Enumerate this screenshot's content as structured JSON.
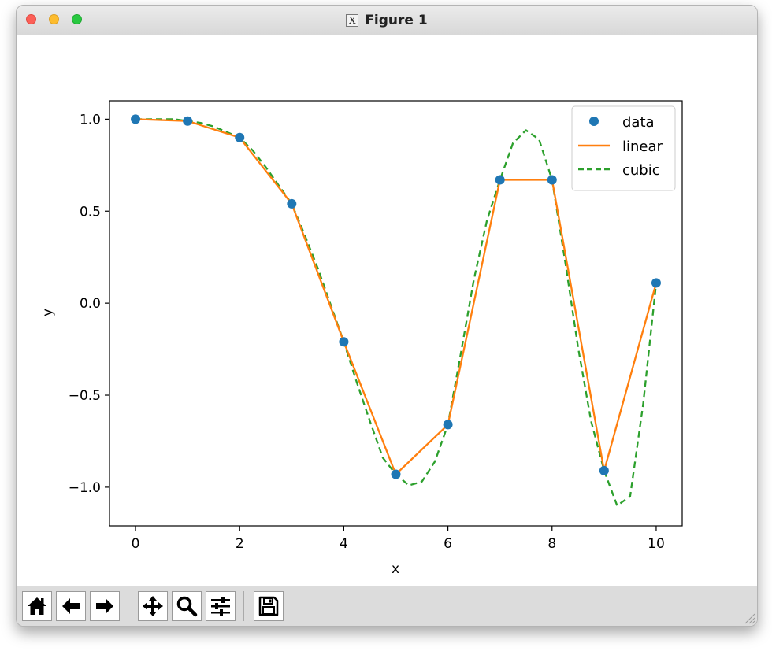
{
  "window": {
    "title": "Figure 1",
    "title_icon": "X"
  },
  "toolbar": {
    "buttons": [
      {
        "name": "home-button",
        "icon": "home-icon"
      },
      {
        "name": "back-button",
        "icon": "arrow-left-icon"
      },
      {
        "name": "forward-button",
        "icon": "arrow-right-icon"
      },
      {
        "name": "pan-button",
        "icon": "move-icon"
      },
      {
        "name": "zoom-button",
        "icon": "magnifier-icon"
      },
      {
        "name": "configure-subplots-button",
        "icon": "sliders-icon"
      },
      {
        "name": "save-button",
        "icon": "floppy-disk-icon"
      }
    ]
  },
  "chart_data": {
    "type": "line",
    "xlabel": "x",
    "ylabel": "y",
    "xlim": [
      -0.5,
      10.5
    ],
    "ylim": [
      -1.21,
      1.1
    ],
    "xticks": [
      0,
      2,
      4,
      6,
      8,
      10
    ],
    "xtick_labels": [
      "0",
      "2",
      "4",
      "6",
      "8",
      "10"
    ],
    "yticks": [
      1.0,
      0.5,
      0.0,
      -0.5,
      -1.0
    ],
    "ytick_labels": [
      "1.0",
      "0.5",
      "0.0",
      "−0.5",
      "−1.0"
    ],
    "grid": false,
    "legend_position": "top-right",
    "series": [
      {
        "name": "data",
        "style": "markers",
        "color": "#1f77b4",
        "x": [
          0,
          1,
          2,
          3,
          4,
          5,
          6,
          7,
          8,
          9,
          10
        ],
        "y": [
          1.0,
          0.99,
          0.9,
          0.54,
          -0.21,
          -0.93,
          -0.66,
          0.67,
          0.67,
          -0.91,
          0.11
        ]
      },
      {
        "name": "linear",
        "style": "solid",
        "color": "#ff7f0e",
        "x": [
          0,
          1,
          2,
          3,
          4,
          5,
          6,
          7,
          8,
          9,
          10
        ],
        "y": [
          1.0,
          0.99,
          0.9,
          0.54,
          -0.21,
          -0.93,
          -0.66,
          0.67,
          0.67,
          -0.91,
          0.11
        ]
      },
      {
        "name": "cubic",
        "style": "dashed",
        "color": "#2ca02c",
        "x": [
          0,
          0.25,
          0.5,
          0.75,
          1,
          1.25,
          1.5,
          1.75,
          2,
          2.25,
          2.5,
          2.75,
          3,
          3.25,
          3.5,
          3.75,
          4,
          4.25,
          4.5,
          4.75,
          5,
          5.25,
          5.5,
          5.75,
          6,
          6.25,
          6.5,
          6.75,
          7,
          7.25,
          7.5,
          7.75,
          8,
          8.25,
          8.5,
          8.75,
          9,
          9.25,
          9.5,
          9.75,
          10
        ],
        "y": [
          1.0,
          1.0,
          1.0,
          1.0,
          0.99,
          0.98,
          0.96,
          0.93,
          0.9,
          0.83,
          0.74,
          0.64,
          0.54,
          0.37,
          0.19,
          -0.01,
          -0.21,
          -0.43,
          -0.64,
          -0.84,
          -0.93,
          -0.99,
          -0.97,
          -0.86,
          -0.66,
          -0.27,
          0.13,
          0.45,
          0.67,
          0.87,
          0.94,
          0.89,
          0.67,
          0.23,
          -0.24,
          -0.64,
          -0.91,
          -1.1,
          -1.05,
          -0.55,
          0.11
        ]
      }
    ]
  }
}
